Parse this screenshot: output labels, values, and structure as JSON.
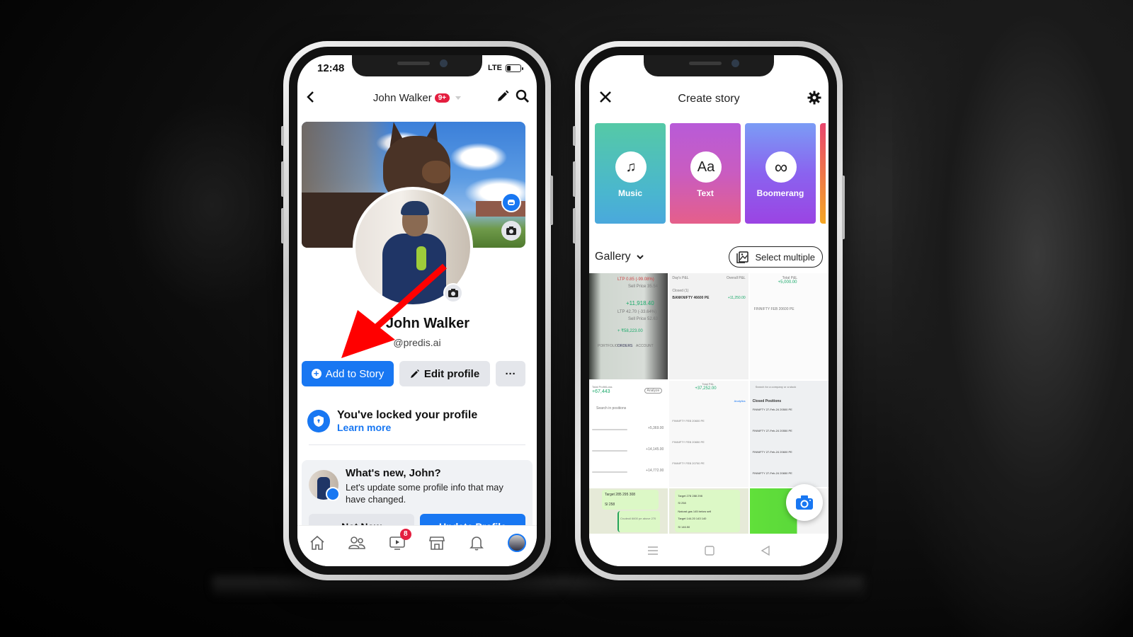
{
  "phone1": {
    "status": {
      "time": "12:48",
      "network": "LTE"
    },
    "header": {
      "title": "John Walker",
      "badge": "9+"
    },
    "profile": {
      "name": "John Walker",
      "handle": "@predis.ai"
    },
    "actions": {
      "add_story": "Add to Story",
      "edit_profile": "Edit profile",
      "more": "···"
    },
    "locked": {
      "title": "You've locked your profile",
      "link": "Learn more"
    },
    "whats_new": {
      "title": "What's new, John?",
      "text": "Let's update some profile info that may have changed.",
      "not_now": "Not Now",
      "update": "Update Profile"
    },
    "tabbar": {
      "items": [
        "home",
        "friends",
        "watch",
        "marketplace",
        "notifications",
        "profile"
      ],
      "watch_badge": "8"
    },
    "annotation": {
      "color": "#ff0000",
      "points_to": "Add to Story"
    }
  },
  "phone2": {
    "header": {
      "title": "Create story"
    },
    "cards": [
      {
        "label": "Music",
        "icon": "♫"
      },
      {
        "label": "Text",
        "icon": "Aa"
      },
      {
        "label": "Boomerang",
        "icon": "∞"
      }
    ],
    "gallery": {
      "label": "Gallery",
      "select_multiple": "Select multiple"
    },
    "thumbnails": {
      "t1": {
        "ltp1": "LTP 0.85 (-99.08%)",
        "sell1": "Sell Price 35.54",
        "pnl": "+11,918.40",
        "ltp2": "LTP 42.70 (-33.64%)",
        "sell2": "Sell Price 52.63",
        "total": "+ ₹58,223.00",
        "tabs": [
          "PORTFOLIO",
          "ORDERS",
          "ACCOUNT"
        ]
      },
      "t2": {
        "days_pnl": "Day's P&L",
        "overall": "Overall P&L",
        "v1": "+11,250.00",
        "closed": "Closed (1)",
        "symbol": "BANKNIFTY 46600 PE",
        "pnl": "+11,250.00"
      },
      "t3": {
        "label": "Total P&L",
        "value": "+5,000.00",
        "symbol": "FINNIFTY FEB 20600 PE"
      },
      "t4": {
        "label": "Total Profit/Loss",
        "value": "+67,443",
        "analyze": "Analyze",
        "search": "Search in positions",
        "rows": [
          "+5,369.00",
          "+14,145.00",
          "+14,772.00"
        ]
      },
      "t5": {
        "label": "Total P&L",
        "value": "+37,252.00",
        "analytics": "Analytics",
        "rows": [
          "FINNIFTY FEB 20600 PE",
          "FINNIFTY FEB 20650 PE",
          "FINNIFTY FEB 20700 PE"
        ]
      },
      "t6": {
        "search": "Search for a company or a stock",
        "closed": "Closed Positions",
        "rows": [
          "FINNIFTY 27-Feb-24 20500 PE",
          "FINNIFTY 27-Feb-24 20550 PE",
          "FINNIFTY 27-Feb-24 20600 PE",
          "FINNIFTY 27-Feb-24 20650 PE"
        ]
      },
      "t7": {
        "target": "Target 285 295 308",
        "sl": "Sl 258",
        "reply": "Crudeoil 6600 pe above 270"
      },
      "t8": {
        "target": "Target 278 288 298",
        "sl": "Sl 258",
        "msg": "Natural gas 145 below sell",
        "target2": "Target 144.20 143 140",
        "sl2": "Sl 146.50"
      }
    }
  }
}
